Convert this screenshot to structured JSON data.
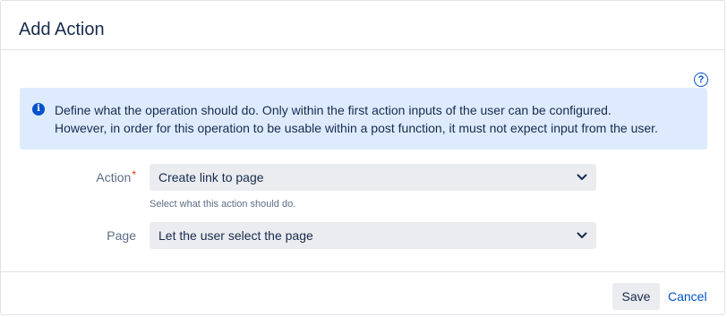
{
  "dialog": {
    "title": "Add Action",
    "help_icon_glyph": "?",
    "info": {
      "icon": "info-icon",
      "icon_glyph": "i",
      "line1": "Define what the operation should do. Only within the first action inputs of the user can be configured.",
      "line2": "However, in order for this operation to be usable within a post function, it must not expect input from the user."
    },
    "fields": {
      "action": {
        "label": "Action",
        "required_marker": "*",
        "value": "Create link to page",
        "hint": "Select what this action should do."
      },
      "page": {
        "label": "Page",
        "value": "Let the user select the page"
      }
    },
    "footer": {
      "save_label": "Save",
      "cancel_label": "Cancel"
    }
  },
  "colors": {
    "accent": "#0052cc",
    "info_background": "#deebff",
    "select_background": "#ebecf0",
    "required": "#de350b",
    "text": "#172b4d",
    "subtle_text": "#5e6c84"
  }
}
